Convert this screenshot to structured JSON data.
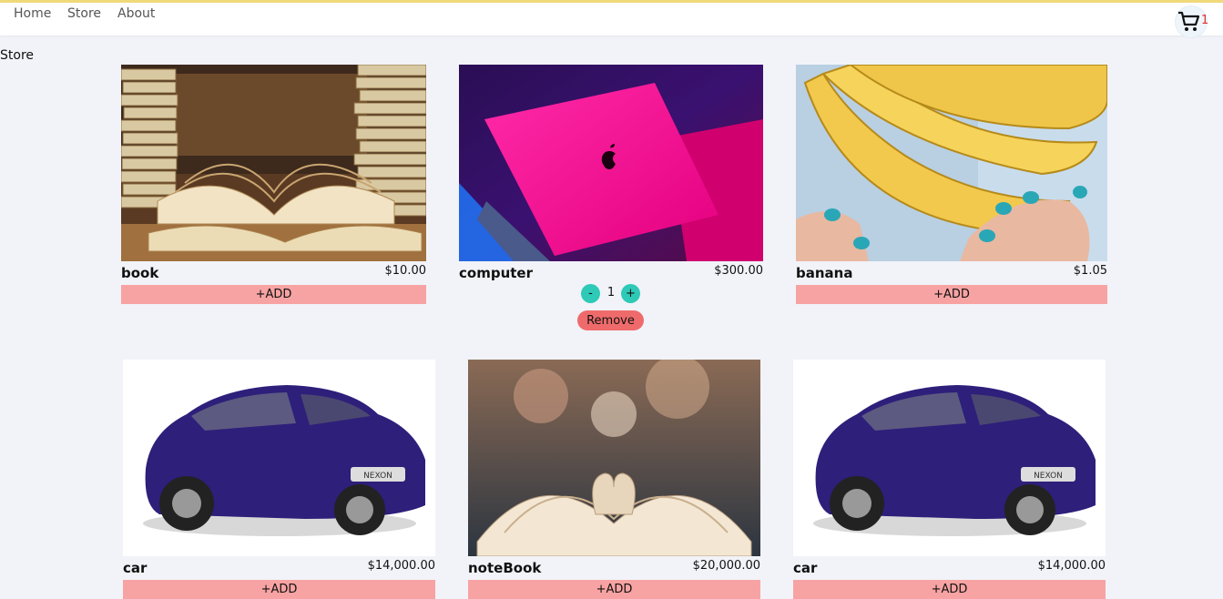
{
  "nav": {
    "links": [
      {
        "label": "Home"
      },
      {
        "label": "Store"
      },
      {
        "label": "About"
      }
    ],
    "cart": {
      "count": "1",
      "icon": "cart-icon"
    }
  },
  "page": {
    "title": "Store"
  },
  "colors": {
    "add_button": "#f8a3a3",
    "qty_button": "#2ec9b7",
    "remove_button": "#ef6b6b",
    "background": "#f1f3f8",
    "cart_badge": "#e03131"
  },
  "products": [
    {
      "name": "book",
      "price": "$10.00",
      "add_label": "+ADD",
      "image": "stack-of-open-books"
    },
    {
      "name": "computer",
      "price": "$300.00",
      "quantity": "1",
      "minus_label": "-",
      "plus_label": "+",
      "remove_label": "Remove",
      "image": "pink-laptop"
    },
    {
      "name": "banana",
      "price": "$1.05",
      "add_label": "+ADD",
      "image": "bananas-in-hands"
    },
    {
      "name": "car",
      "price": "$14,000.00",
      "add_label": "+ADD",
      "image": "blue-suv-nexon"
    },
    {
      "name": "noteBook",
      "price": "$20,000.00",
      "add_label": "+ADD",
      "image": "open-book-heart"
    },
    {
      "name": "car",
      "price": "$14,000.00",
      "add_label": "+ADD",
      "image": "blue-suv-nexon"
    }
  ]
}
